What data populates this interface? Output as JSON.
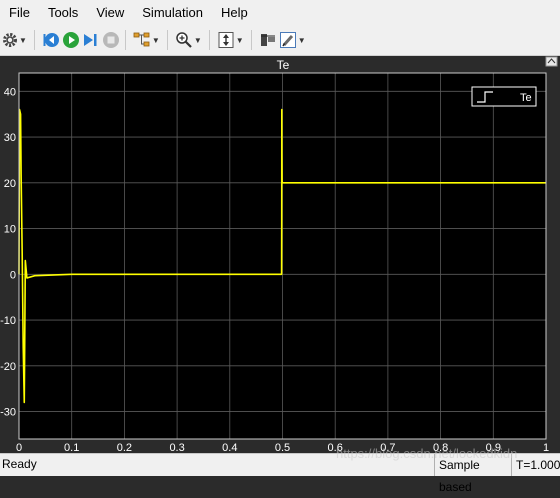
{
  "menu": [
    "File",
    "Tools",
    "View",
    "Simulation",
    "Help"
  ],
  "plot": {
    "title": "Te",
    "legend": "Te",
    "background": "#000000",
    "frame_background": "#2b2b2b",
    "trace_color": "#ffff00",
    "grid_color": "#5a5a5a",
    "text_color": "#ffffff",
    "x_ticks": [
      "0",
      "0.1",
      "0.2",
      "0.3",
      "0.4",
      "0.5",
      "0.6",
      "0.7",
      "0.8",
      "0.9",
      "1"
    ],
    "y_ticks": [
      "40",
      "30",
      "20",
      "10",
      "0",
      "-10",
      "-20",
      "-30"
    ]
  },
  "chart_data": {
    "type": "line",
    "title": "Te",
    "series": [
      {
        "name": "Te",
        "x": [
          0,
          0.001,
          0.003,
          0.004,
          0.006,
          0.008,
          0.01,
          0.012,
          0.015,
          0.03,
          0.1,
          0.3,
          0.4983,
          0.4985,
          0.4987,
          0.4989,
          0.4992,
          0.4995,
          0.5,
          0.502,
          0.55,
          0.7,
          0.9,
          1.0
        ],
        "y": [
          0,
          36,
          35,
          22,
          5,
          -16,
          -28,
          3,
          -0.8,
          -0.3,
          0,
          0,
          0,
          11,
          36,
          26,
          20.5,
          20.2,
          20,
          20,
          20,
          20,
          20,
          20
        ]
      }
    ],
    "xlim": [
      0,
      1
    ],
    "ylim": [
      -36,
      44
    ],
    "grid": true,
    "legend_position": "top-right"
  },
  "status": {
    "ready": "Ready",
    "mode": "Sample based",
    "time": "T=1.000"
  },
  "watermark": "https://blog.csdn.net/lockedkidn"
}
